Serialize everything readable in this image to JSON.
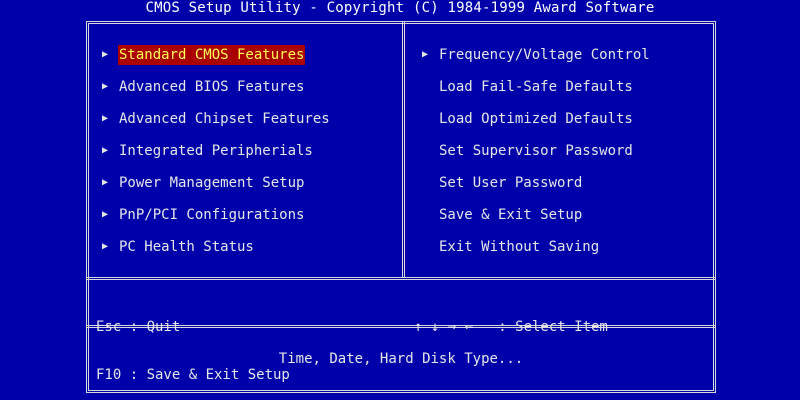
{
  "title": "CMOS Setup Utility - Copyright (C) 1984-1999 Award Software",
  "icons": {
    "submenu": "triangle-right-icon"
  },
  "colors": {
    "background": "#0000aa",
    "text": "#e6e6e6",
    "selected_bg": "#aa0000",
    "selected_text": "#ffff55"
  },
  "menu_left": [
    {
      "label": "Standard CMOS Features",
      "submenu": true,
      "selected": true
    },
    {
      "label": "Advanced BIOS Features",
      "submenu": true
    },
    {
      "label": "Advanced Chipset Features",
      "submenu": true
    },
    {
      "label": "Integrated Peripherials",
      "submenu": true
    },
    {
      "label": "Power Management Setup",
      "submenu": true
    },
    {
      "label": "PnP/PCI Configurations",
      "submenu": true
    },
    {
      "label": "PC Health Status",
      "submenu": true
    }
  ],
  "menu_right": [
    {
      "label": "Frequency/Voltage Control",
      "submenu": true
    },
    {
      "label": "Load Fail-Safe Defaults"
    },
    {
      "label": "Load Optimized Defaults"
    },
    {
      "label": "Set Supervisor Password"
    },
    {
      "label": "Set User Password"
    },
    {
      "label": "Save & Exit Setup"
    },
    {
      "label": "Exit Without Saving"
    }
  ],
  "keys": {
    "esc": "Esc : Quit",
    "f10": "F10 : Save & Exit Setup",
    "select": "↑ ↓ → ←   : Select Item"
  },
  "help_text": "Time, Date, Hard Disk Type..."
}
